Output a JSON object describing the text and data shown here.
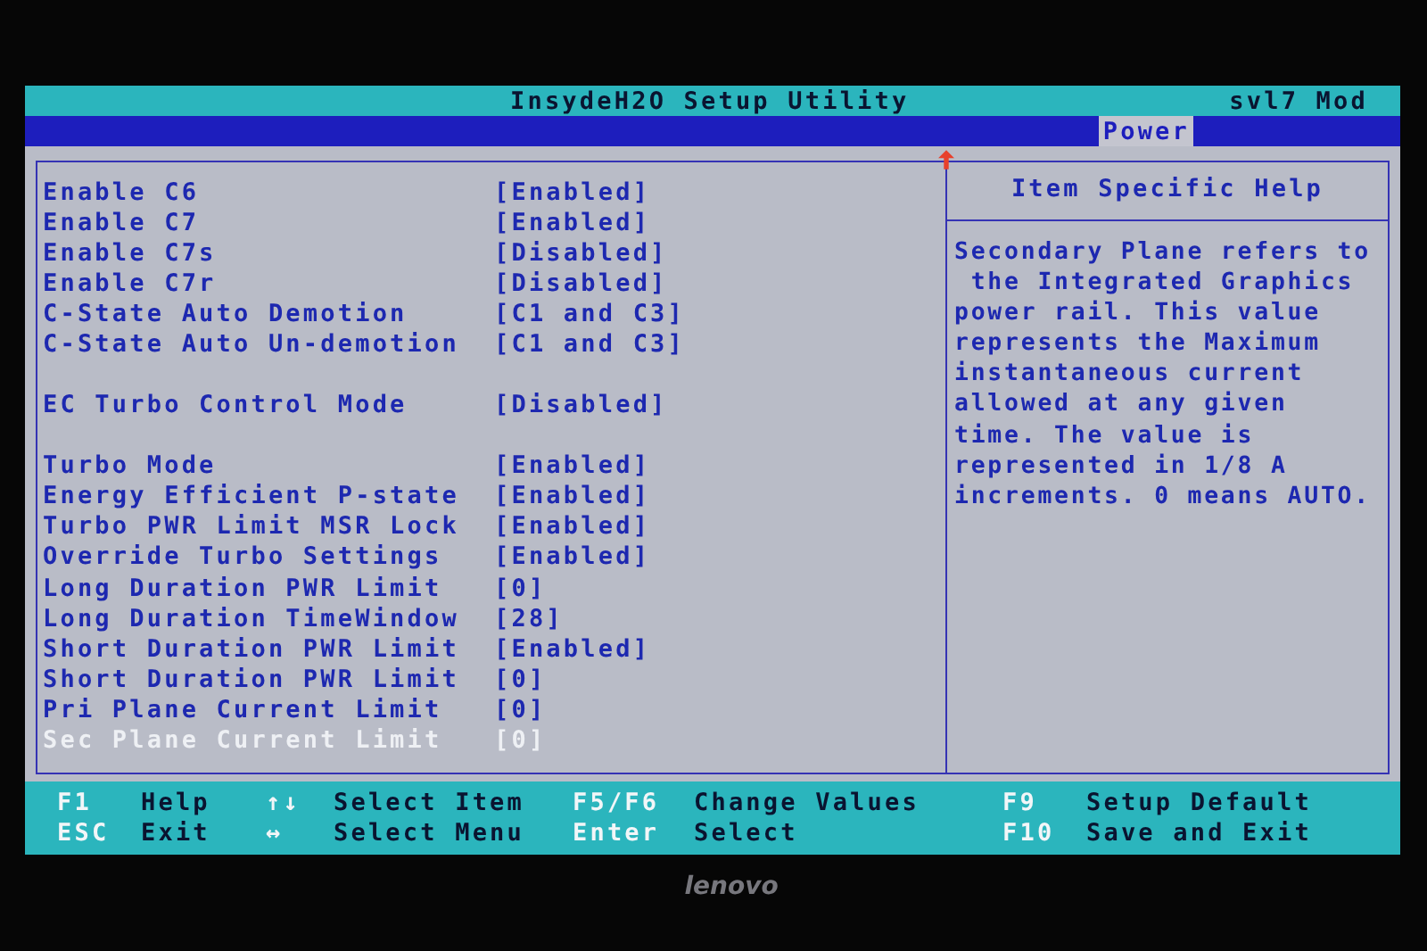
{
  "title_bar": {
    "title": "InsydeH2O Setup Utility",
    "right_text": "svl7 Mod"
  },
  "tabs": [
    {
      "label": "Power",
      "selected": true
    }
  ],
  "settings": {
    "groups": [
      [
        {
          "label": "Enable C6",
          "value": "[Enabled]",
          "selected": false
        },
        {
          "label": "Enable C7",
          "value": "[Enabled]",
          "selected": false
        },
        {
          "label": "Enable C7s",
          "value": "[Disabled]",
          "selected": false
        },
        {
          "label": "Enable C7r",
          "value": "[Disabled]",
          "selected": false
        },
        {
          "label": "C-State Auto Demotion",
          "value": "[C1 and C3]",
          "selected": false
        },
        {
          "label": "C-State Auto Un-demotion",
          "value": "[C1 and C3]",
          "selected": false
        }
      ],
      [
        {
          "label": "EC Turbo Control Mode",
          "value": "[Disabled]",
          "selected": false
        }
      ],
      [
        {
          "label": "Turbo Mode",
          "value": "[Enabled]",
          "selected": false
        },
        {
          "label": "Energy Efficient P-state",
          "value": "[Enabled]",
          "selected": false
        },
        {
          "label": "Turbo PWR Limit MSR Lock",
          "value": "[Enabled]",
          "selected": false
        },
        {
          "label": "Override Turbo Settings",
          "value": "[Enabled]",
          "selected": false
        },
        {
          "label": "Long Duration PWR Limit",
          "value": "[0]",
          "selected": false
        },
        {
          "label": "Long Duration TimeWindow",
          "value": "[28]",
          "selected": false
        },
        {
          "label": "Short Duration PWR Limit",
          "value": "[Enabled]",
          "selected": false
        },
        {
          "label": "Short Duration PWR Limit",
          "value": "[0]",
          "selected": false
        },
        {
          "label": "Pri Plane Current Limit",
          "value": "[0]",
          "selected": false
        },
        {
          "label": "Sec Plane Current Limit",
          "value": "[0]",
          "selected": true
        }
      ]
    ]
  },
  "help": {
    "title": "Item Specific Help",
    "lines": [
      "Secondary Plane refers to",
      " the Integrated Graphics",
      "power rail. This value",
      "represents the Maximum",
      "instantaneous current",
      "allowed at any given",
      "time. The value is",
      "represented in 1/8 A",
      "increments. 0 means AUTO."
    ]
  },
  "footer": {
    "rows": [
      [
        {
          "key": "F1",
          "action": "Help"
        },
        {
          "key": "↑↓",
          "action": "Select Item"
        },
        {
          "key": "F5/F6",
          "action": "Change Values"
        },
        {
          "key": "F9",
          "action": "Setup Default"
        }
      ],
      [
        {
          "key": "ESC",
          "action": "Exit"
        },
        {
          "key": "↔",
          "action": "Select Menu"
        },
        {
          "key": "Enter",
          "action": "Select"
        },
        {
          "key": "F10",
          "action": "Save and Exit"
        }
      ]
    ]
  },
  "bezel": {
    "logo": "lenovo"
  }
}
